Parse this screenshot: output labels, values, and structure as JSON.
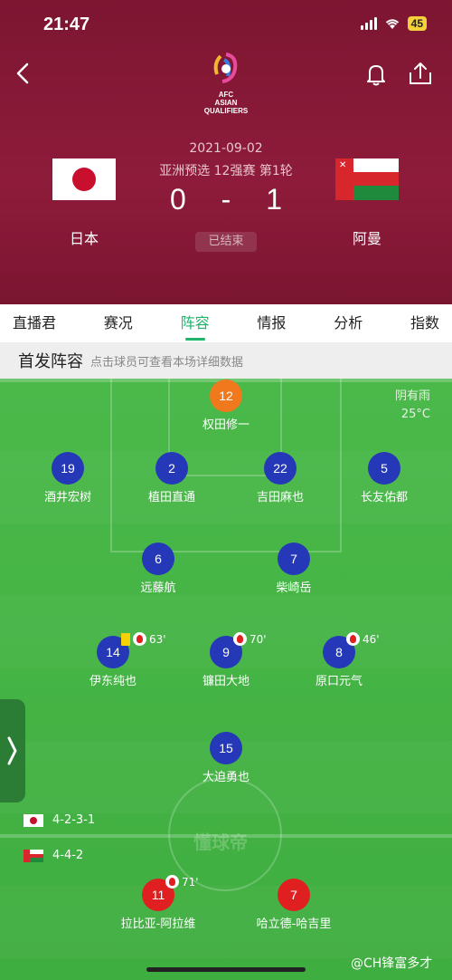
{
  "status_bar": {
    "time": "21:47",
    "battery": "45"
  },
  "match": {
    "logo_lines": [
      "AFC",
      "ASIAN",
      "QUALIFIERS"
    ],
    "date": "2021-09-02",
    "competition": "亚洲预选 12强赛 第1轮",
    "home_score": "0",
    "separator": "-",
    "away_score": "1",
    "status": "已结束",
    "home_team": "日本",
    "away_team": "阿曼"
  },
  "tabs": [
    "直播君",
    "赛况",
    "阵容",
    "情报",
    "分析",
    "指数"
  ],
  "active_tab": "阵容",
  "lineup": {
    "title": "首发阵容",
    "hint": "点击球员可查看本场详细数据",
    "weather": "阴有雨",
    "temperature": "25°C",
    "home_formation": "4-2-3-1",
    "away_formation": "4-4-2",
    "pitch_logo": "懂球帝"
  },
  "players": {
    "p12": {
      "number": "12",
      "name": "权田修一"
    },
    "p19": {
      "number": "19",
      "name": "酒井宏树"
    },
    "p2": {
      "number": "2",
      "name": "植田直通"
    },
    "p22": {
      "number": "22",
      "name": "吉田麻也"
    },
    "p5": {
      "number": "5",
      "name": "长友佑都"
    },
    "p6": {
      "number": "6",
      "name": "远藤航"
    },
    "p7": {
      "number": "7",
      "name": "柴崎岳"
    },
    "p14": {
      "number": "14",
      "name": "伊东纯也",
      "sub_minute": "63'"
    },
    "p9": {
      "number": "9",
      "name": "镰田大地",
      "sub_minute": "70'"
    },
    "p8": {
      "number": "8",
      "name": "原口元气",
      "sub_minute": "46'"
    },
    "p15": {
      "number": "15",
      "name": "大迫勇也"
    },
    "o11": {
      "number": "11",
      "name": "拉比亚-阿拉维",
      "sub_minute": "71'"
    },
    "o7": {
      "number": "7",
      "name": "哈立德-哈吉里"
    }
  },
  "watermark": "@CH锋富多才"
}
